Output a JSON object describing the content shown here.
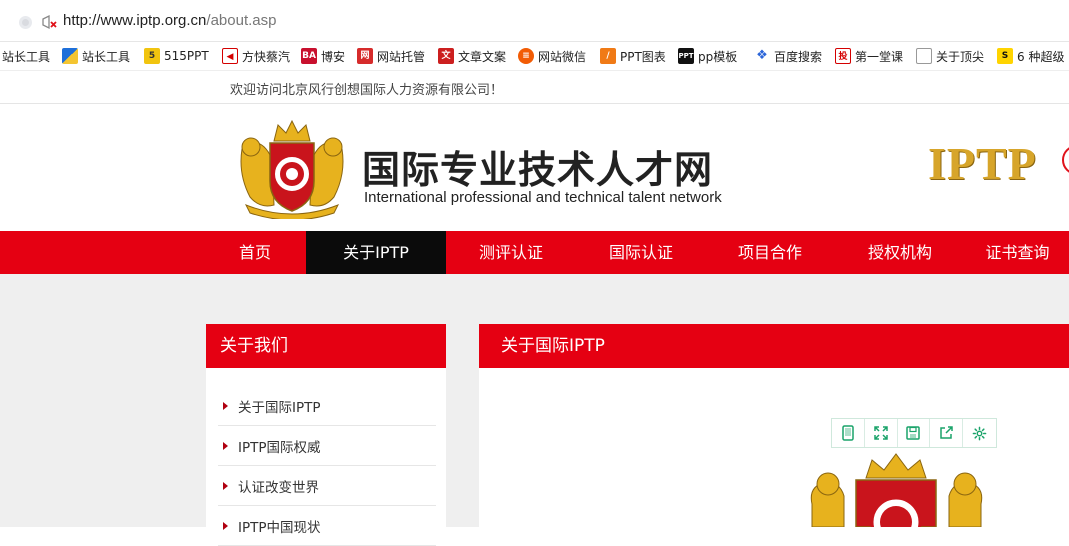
{
  "browser": {
    "url_host": "http://www.iptp.org.cn",
    "url_path": "/about.asp"
  },
  "bookmarks": [
    {
      "label": "站长工具",
      "icon": "page-icon"
    },
    {
      "label": "站长工具",
      "icon": "chart-icon"
    },
    {
      "label": "515PPT",
      "icon": "s-logo-icon"
    },
    {
      "label": "方快蔡汽",
      "icon": "red-flag-icon"
    },
    {
      "label": "博安",
      "icon": "ba-logo-icon"
    },
    {
      "label": "网站托管",
      "icon": "red-square-icon"
    },
    {
      "label": "文章文案",
      "icon": "red-square-icon"
    },
    {
      "label": "网站微信",
      "icon": "orange-circle-icon"
    },
    {
      "label": "PPT图表",
      "icon": "orange-square-icon"
    },
    {
      "label": "pp模板",
      "icon": "ppt-logo-icon"
    },
    {
      "label": "百度搜索",
      "icon": "paw-icon"
    },
    {
      "label": "第一堂课",
      "icon": "red-chinese-icon"
    },
    {
      "label": "关于顶尖",
      "icon": "page-icon"
    },
    {
      "label": "6 种超级",
      "icon": "s-yellow-icon"
    }
  ],
  "welcome_text": "欢迎访问北京风行创想国际人力资源有限公司！",
  "header": {
    "title": "国际专业技术人才网",
    "subtitle": "International professional and technical talent network",
    "brand": "IPTP"
  },
  "nav": [
    {
      "label": "首页",
      "active": false
    },
    {
      "label": "关于IPTP",
      "active": true
    },
    {
      "label": "测评认证",
      "active": false
    },
    {
      "label": "国际认证",
      "active": false
    },
    {
      "label": "项目合作",
      "active": false
    },
    {
      "label": "授权机构",
      "active": false
    },
    {
      "label": "证书查询",
      "active": false
    }
  ],
  "sidebar": {
    "title": "关于我们",
    "items": [
      "关于国际IPTP",
      "IPTP国际权威",
      "认证改变世界",
      "IPTP中国现状"
    ]
  },
  "main": {
    "title": "关于国际IPTP",
    "toolbar": [
      "phone-icon",
      "expand-icon",
      "save-icon",
      "share-icon",
      "settings-icon"
    ]
  },
  "colors": {
    "primary_red": "#e50012",
    "nav_active": "#0b0b0b",
    "gold": "#d7a52a",
    "toolbar_green": "#1aa36a"
  }
}
